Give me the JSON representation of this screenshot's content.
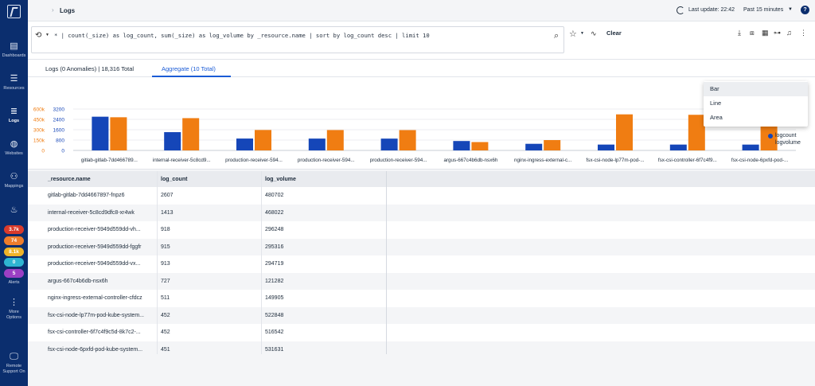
{
  "breadcrumb": {
    "title": "Logs"
  },
  "topbar": {
    "last_update": "Last update: 22:42",
    "range": "Past 15 minutes",
    "help": "?"
  },
  "sidebar": {
    "items": [
      {
        "label": "Dashboards",
        "icon": "dashboards-icon"
      },
      {
        "label": "Resources",
        "icon": "resources-icon"
      },
      {
        "label": "Logs",
        "icon": "logs-icon"
      },
      {
        "label": "Websites",
        "icon": "websites-icon"
      },
      {
        "label": "Mappings",
        "icon": "mappings-icon"
      },
      {
        "label": "Alerts",
        "icon": "alerts-icon"
      },
      {
        "label": "More Options",
        "icon": "more-options-icon"
      },
      {
        "label": "Remote Support On",
        "icon": "remote-support-icon"
      }
    ],
    "alert_counts": [
      {
        "value": "3.7k",
        "color": "#d93b2b"
      },
      {
        "value": "74",
        "color": "#ee7d2b"
      },
      {
        "value": "8.1k",
        "color": "#f0b429"
      },
      {
        "value": "0",
        "color": "#2fb5d2"
      },
      {
        "value": "5",
        "color": "#9b3fc4"
      }
    ]
  },
  "query": {
    "text": "* | count(_size) as log_count, sum(_size) as log_volume by _resource.name | sort by log_count desc | limit 10",
    "clear_label": "Clear"
  },
  "tabs": [
    {
      "label": "Logs (0 Anomalies) | 18,316 Total",
      "active": false
    },
    {
      "label": "Aggregate (10 Total)",
      "active": true
    }
  ],
  "chart_type_menu": {
    "options": [
      "Bar",
      "Line",
      "Area"
    ],
    "selected": "Bar"
  },
  "chart_data": {
    "type": "bar",
    "categories": [
      "gitlab-gitlab-7dd466789...",
      "internal-receiver-5c8cd9...",
      "production-receiver-594...",
      "production-receiver-594...",
      "production-receiver-594...",
      "argus-667c4b6db-nsx6h",
      "nginx-ingress-external-c...",
      "fsx-csi-node-lp77m-pod-...",
      "fsx-csi-controller-6f7c4f9...",
      "fsx-csi-node-6pxfd-pod-..."
    ],
    "series": [
      {
        "name": "logcount",
        "color": "#1546b8",
        "values": [
          2607,
          1413,
          918,
          915,
          913,
          727,
          511,
          452,
          452,
          451
        ]
      },
      {
        "name": "logvolume",
        "color": "#f07d12",
        "values": [
          480702,
          468022,
          296248,
          295316,
          294719,
          121282,
          149905,
          522848,
          516542,
          531631
        ]
      }
    ],
    "y_left_ticks": [
      "3200",
      "2400",
      "1600",
      "800",
      "0"
    ],
    "y_right_ticks": [
      "600k",
      "450k",
      "300k",
      "150k",
      "0"
    ],
    "y_left_range": [
      0,
      3200
    ],
    "y_right_range": [
      0,
      600000
    ],
    "legend_position": "right",
    "grid": true
  },
  "table": {
    "columns": [
      "_resource.name",
      "log_count",
      "log_volume"
    ],
    "rows": [
      [
        "gitlab-gitlab-7dd4667897-fnpz6",
        "2607",
        "480702"
      ],
      [
        "internal-receiver-5c8cd9dfc8-xr4wk",
        "1413",
        "468022"
      ],
      [
        "production-receiver-5949d559dd-vh...",
        "918",
        "296248"
      ],
      [
        "production-receiver-5949d559dd-fggfr",
        "915",
        "295316"
      ],
      [
        "production-receiver-5949d559dd-vx...",
        "913",
        "294719"
      ],
      [
        "argus-667c4b6db-nsx6h",
        "727",
        "121282"
      ],
      [
        "nginx-ingress-external-controller-cfdcz",
        "511",
        "149905"
      ],
      [
        "fsx-csi-node-lp77m-pod-kube-system...",
        "452",
        "522848"
      ],
      [
        "fsx-csi-controller-6f7c4f9c5d-8k7c2-...",
        "452",
        "516542"
      ],
      [
        "fsx-csi-node-6pxfd-pod-kube-system...",
        "451",
        "531631"
      ]
    ]
  }
}
